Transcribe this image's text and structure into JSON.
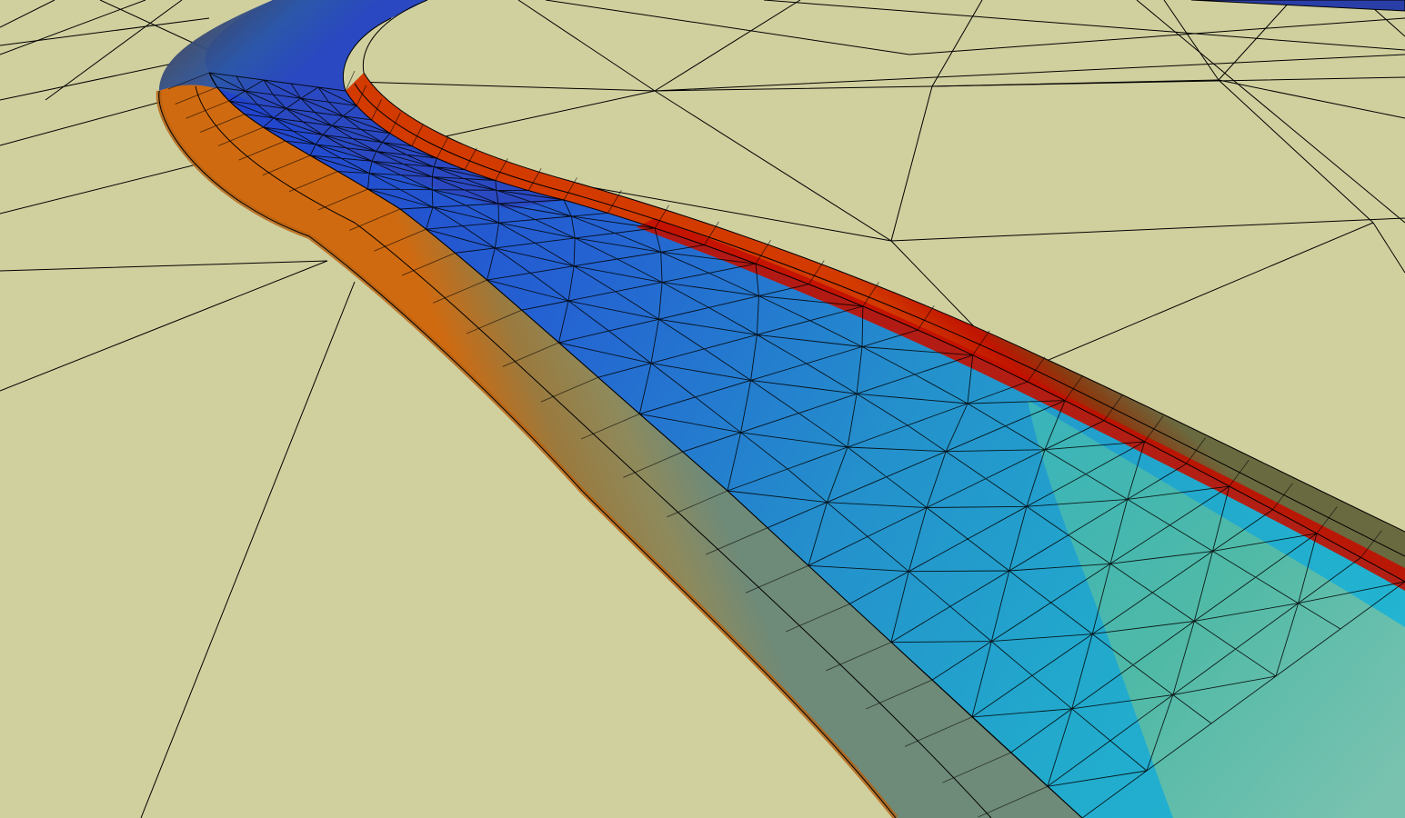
{
  "scene": {
    "subject": "",
    "colors": {
      "background": "#d0cf9e",
      "mesh_lines": "#000000",
      "deep_blue": "#2244cc",
      "mid_blue": "#2478d0",
      "cyan": "#22b6cc",
      "teal": "#56bba0",
      "light_teal": "#86c0a8",
      "shoulder_brown": "#8a7e52",
      "hot_orange": "#e06a10",
      "hot_red": "#c01000",
      "dark_red": "#8a1800"
    }
  }
}
